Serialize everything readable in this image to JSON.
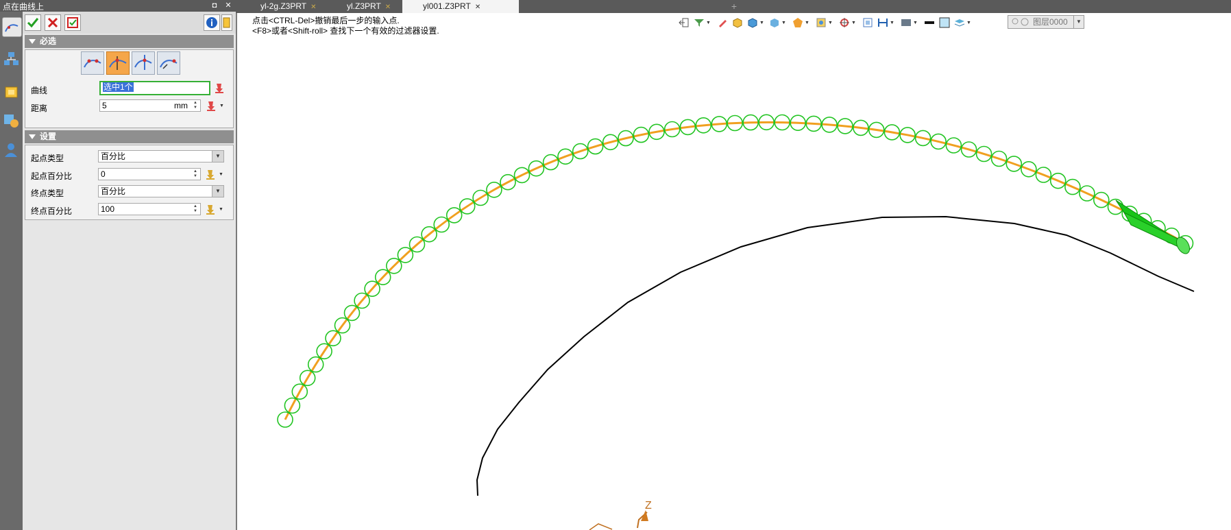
{
  "panel": {
    "title": "点在曲线上",
    "title_buttons": {
      "pin": "◘",
      "close": "✕"
    },
    "toolbar": {
      "ok": "✔",
      "cancel": "✖",
      "apply": "↻",
      "info": "i"
    },
    "required": {
      "header": "必选",
      "curve_label": "曲线",
      "curve_value": "选中1个",
      "distance_label": "距离",
      "distance_value": "5",
      "distance_unit": "mm"
    },
    "settings": {
      "header": "设置",
      "start_type_label": "起点类型",
      "start_type_value": "百分比",
      "start_percent_label": "起点百分比",
      "start_percent_value": "0",
      "end_type_label": "终点类型",
      "end_type_value": "百分比",
      "end_percent_label": "终点百分比",
      "end_percent_value": "100"
    }
  },
  "tabs": [
    {
      "label": "yl-2g.Z3PRT",
      "close": "✕"
    },
    {
      "label": "yl.Z3PRT",
      "close": "✕"
    },
    {
      "label": "yl001.Z3PRT",
      "close": "✕"
    }
  ],
  "add_tab": "+",
  "prompt": {
    "line1": "点击<CTRL-Del>撤销最后一步的输入点.",
    "line2": "<F8>或者<Shift-roll> 查找下一个有效的过滤器设置."
  },
  "layer": {
    "value": "图层0000"
  },
  "axis_label": "Z",
  "colors": {
    "accent_green": "#22c422",
    "curve_orange": "#f0a020",
    "panel_bg": "#e6e6e6",
    "dark_chrome": "#5a5a5a"
  }
}
